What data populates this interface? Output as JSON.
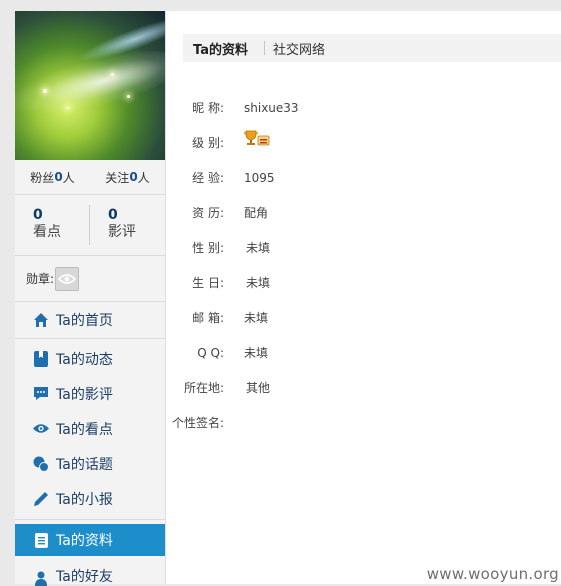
{
  "sidebar": {
    "follow": {
      "fans_label": "粉丝",
      "fans_count": "0",
      "fans_unit": "人",
      "following_label": "关注",
      "following_count": "0",
      "following_unit": "人"
    },
    "stats": [
      {
        "num": "0",
        "label": "看点"
      },
      {
        "num": "0",
        "label": "影评"
      }
    ],
    "medal_label": "勋章:",
    "nav": [
      {
        "label": "Ta的首页",
        "icon": "home-icon"
      },
      {
        "label": "Ta的动态",
        "icon": "bookmark-icon"
      },
      {
        "label": "Ta的影评",
        "icon": "comment-icon"
      },
      {
        "label": "Ta的看点",
        "icon": "eye-icon"
      },
      {
        "label": "Ta的话题",
        "icon": "chat-bubbles-icon"
      },
      {
        "label": "Ta的小报",
        "icon": "pencil-icon"
      },
      {
        "label": "Ta的资料",
        "icon": "document-icon"
      },
      {
        "label": "Ta的好友",
        "icon": "user-icon"
      }
    ],
    "colors": {
      "active_bg": "#1e8ecb",
      "link": "#1d3f66",
      "count": "#0f3a66"
    }
  },
  "main": {
    "tabs": [
      {
        "label": "Ta的资料",
        "active": true
      },
      {
        "label": "社交网络",
        "active": false
      }
    ],
    "profile": [
      {
        "label": "昵 称:",
        "value": "shixue33"
      },
      {
        "label": "级 别:",
        "value": "",
        "icon": "trophy-level-icon"
      },
      {
        "label": "经 验:",
        "value": "1095"
      },
      {
        "label": "资 历:",
        "value": "配角"
      },
      {
        "label": "性 别:",
        "value": "未填"
      },
      {
        "label": "生 日:",
        "value": "未填"
      },
      {
        "label": "邮 箱:",
        "value": "未填"
      },
      {
        "label": "Q Q:",
        "value": "未填"
      },
      {
        "label": "所在地:",
        "value": "其他"
      },
      {
        "label": "个性签名:",
        "value": ""
      }
    ]
  },
  "watermark": "www.wooyun.org"
}
